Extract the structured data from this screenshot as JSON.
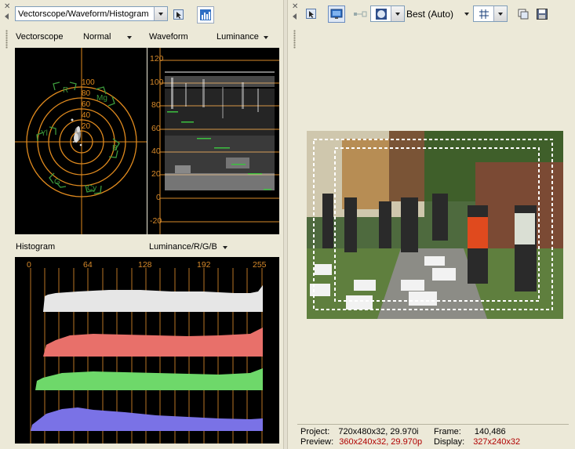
{
  "left": {
    "scope_select": "Vectorscope/Waveform/Histogram",
    "vectorscope": {
      "label": "Vectorscope",
      "mode": "Normal",
      "rings": [
        "100",
        "80",
        "60",
        "40",
        "20"
      ],
      "targets": [
        "R",
        "Mg",
        "B",
        "Cy",
        "G",
        "Yl"
      ]
    },
    "waveform": {
      "label": "Waveform",
      "mode": "Luminance",
      "ticks": [
        "120",
        "100",
        "80",
        "60",
        "40",
        "20",
        "0",
        "-20"
      ]
    },
    "histogram": {
      "label": "Histogram",
      "mode": "Luminance/R/G/B",
      "ticks": [
        "0",
        "64",
        "128",
        "192",
        "255"
      ]
    }
  },
  "right": {
    "quality": "Best (Auto)",
    "status": {
      "project_label": "Project:",
      "project_value": "720x480x32, 29.970i",
      "preview_label": "Preview:",
      "preview_value": "360x240x32, 29.970p",
      "frame_label": "Frame:",
      "frame_value": "140,486",
      "display_label": "Display:",
      "display_value": "327x240x32"
    }
  },
  "colors": {
    "ring": "#e08a1e",
    "target": "#3c9a3c",
    "waveform_line": "#d88a2a",
    "hist_luma": "#e6e6e6",
    "hist_r": "#e8706a",
    "hist_g": "#6ed86a",
    "hist_b": "#7a72e6",
    "status_red": "#b00000"
  }
}
